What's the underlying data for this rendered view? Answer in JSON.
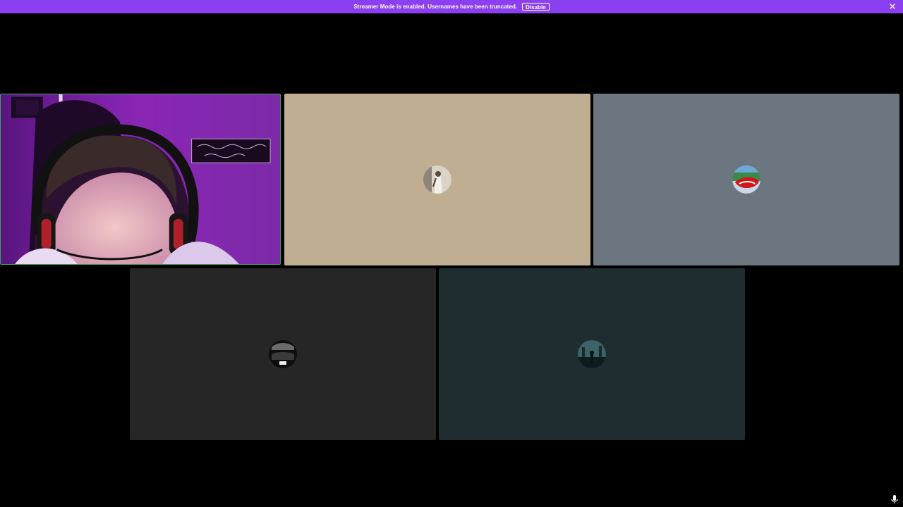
{
  "banner": {
    "message": "Streamer Mode is enabled. Usernames have been truncated.",
    "disable_label": "Disable",
    "color": "#8b3ff0"
  },
  "tiles": [
    {
      "kind": "video",
      "label": "self-camera-feed",
      "speaking": true,
      "color": "#7a1fa8",
      "border_color": "#3ba55c"
    },
    {
      "kind": "avatar",
      "background": "#bfae92",
      "avatar_icon": "portrait-avatar-icon"
    },
    {
      "kind": "avatar",
      "background": "#6c7680",
      "avatar_icon": "red-blue-avatar-icon"
    },
    {
      "kind": "avatar",
      "background": "#262626",
      "avatar_icon": "dark-car-avatar-icon"
    },
    {
      "kind": "avatar",
      "background": "#1f2d30",
      "avatar_icon": "dark-scene-avatar-icon"
    }
  ],
  "icons": {
    "close": "close-icon",
    "mic": "microphone-icon"
  }
}
